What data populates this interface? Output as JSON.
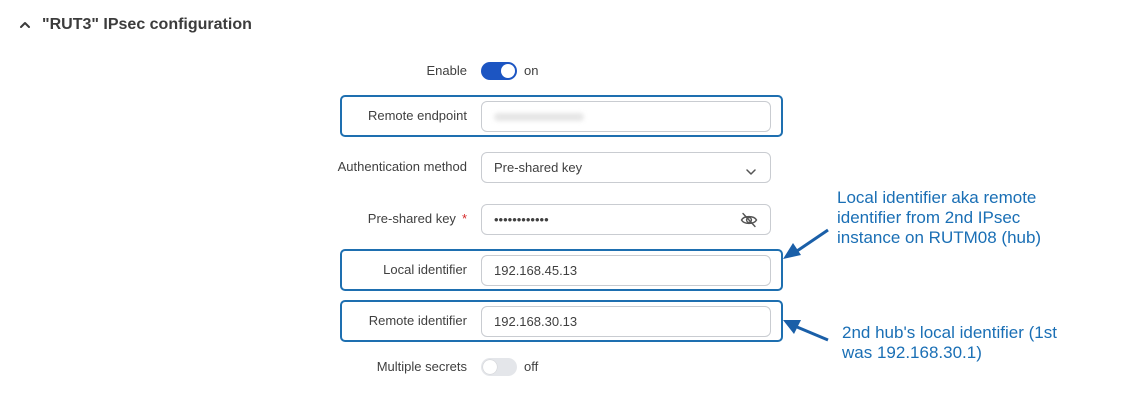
{
  "section": {
    "title": "\"RUT3\" IPsec configuration",
    "collapse_icon": "chevron-up-icon"
  },
  "form": {
    "enable": {
      "label": "Enable",
      "state": "on"
    },
    "remote_endpoint": {
      "label": "Remote endpoint"
    },
    "auth_method": {
      "label": "Authentication method",
      "value": "Pre-shared key",
      "icon": "chevron-down-icon"
    },
    "pre_shared_key": {
      "label": "Pre-shared key",
      "required_mark": "*",
      "value": "••••••••••••",
      "icon": "eye-slash-icon"
    },
    "local_identifier": {
      "label": "Local identifier",
      "value": "192.168.45.13"
    },
    "remote_identifier": {
      "label": "Remote identifier",
      "value": "192.168.30.13"
    },
    "multiple_secrets": {
      "label": "Multiple secrets",
      "state": "off"
    }
  },
  "annotations": {
    "local_note": {
      "line1": "Local identifier aka remote",
      "line2": "identifier from 2nd IPsec",
      "line3": "instance on RUTM08 (hub)"
    },
    "remote_note": {
      "line1": "2nd hub's local identifier (1st",
      "line2": "was 192.168.30.1)"
    },
    "color": "#1a6fb5"
  },
  "colors": {
    "toggle_on": "#1c55c2",
    "toggle_off": "#e4e6ea",
    "required": "#d62828",
    "highlight": "#1e6fb0"
  }
}
